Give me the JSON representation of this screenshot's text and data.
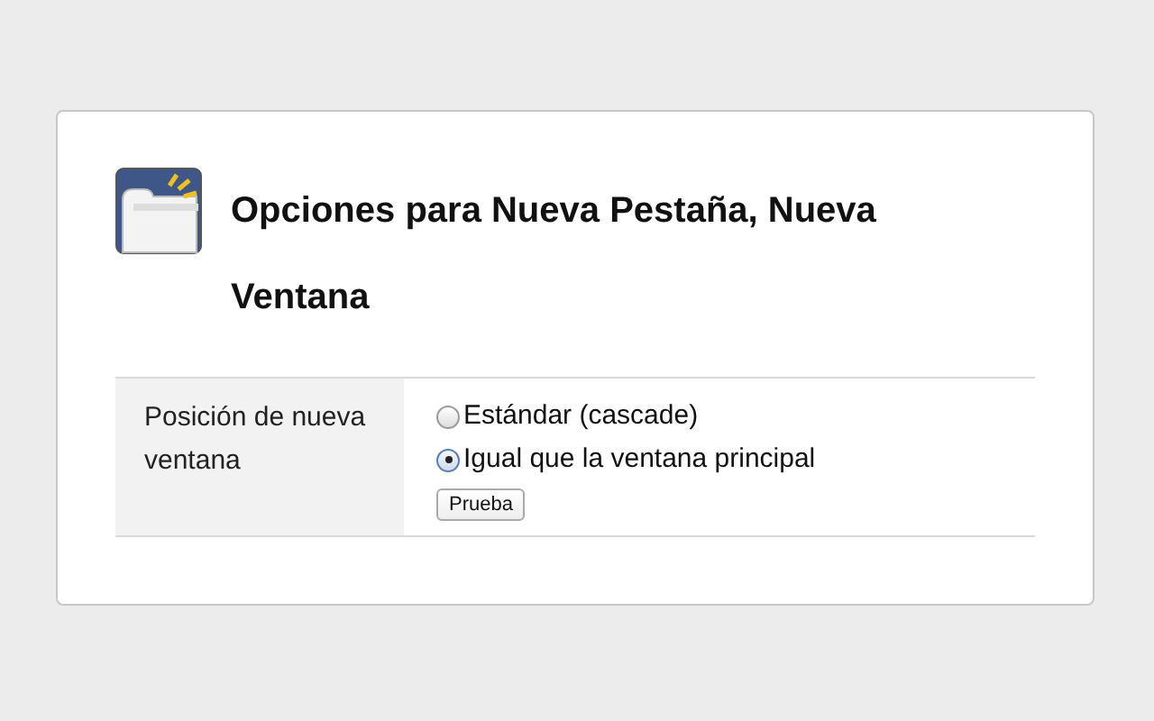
{
  "title": "Opciones para Nueva Pestaña, Nueva Ventana",
  "settings": [
    {
      "label": "Posición de nueva ventana",
      "options": [
        {
          "label": "Estándar (cascade)",
          "selected": false
        },
        {
          "label": "Igual que la ventana principal",
          "selected": true
        }
      ],
      "button": "Prueba"
    }
  ]
}
